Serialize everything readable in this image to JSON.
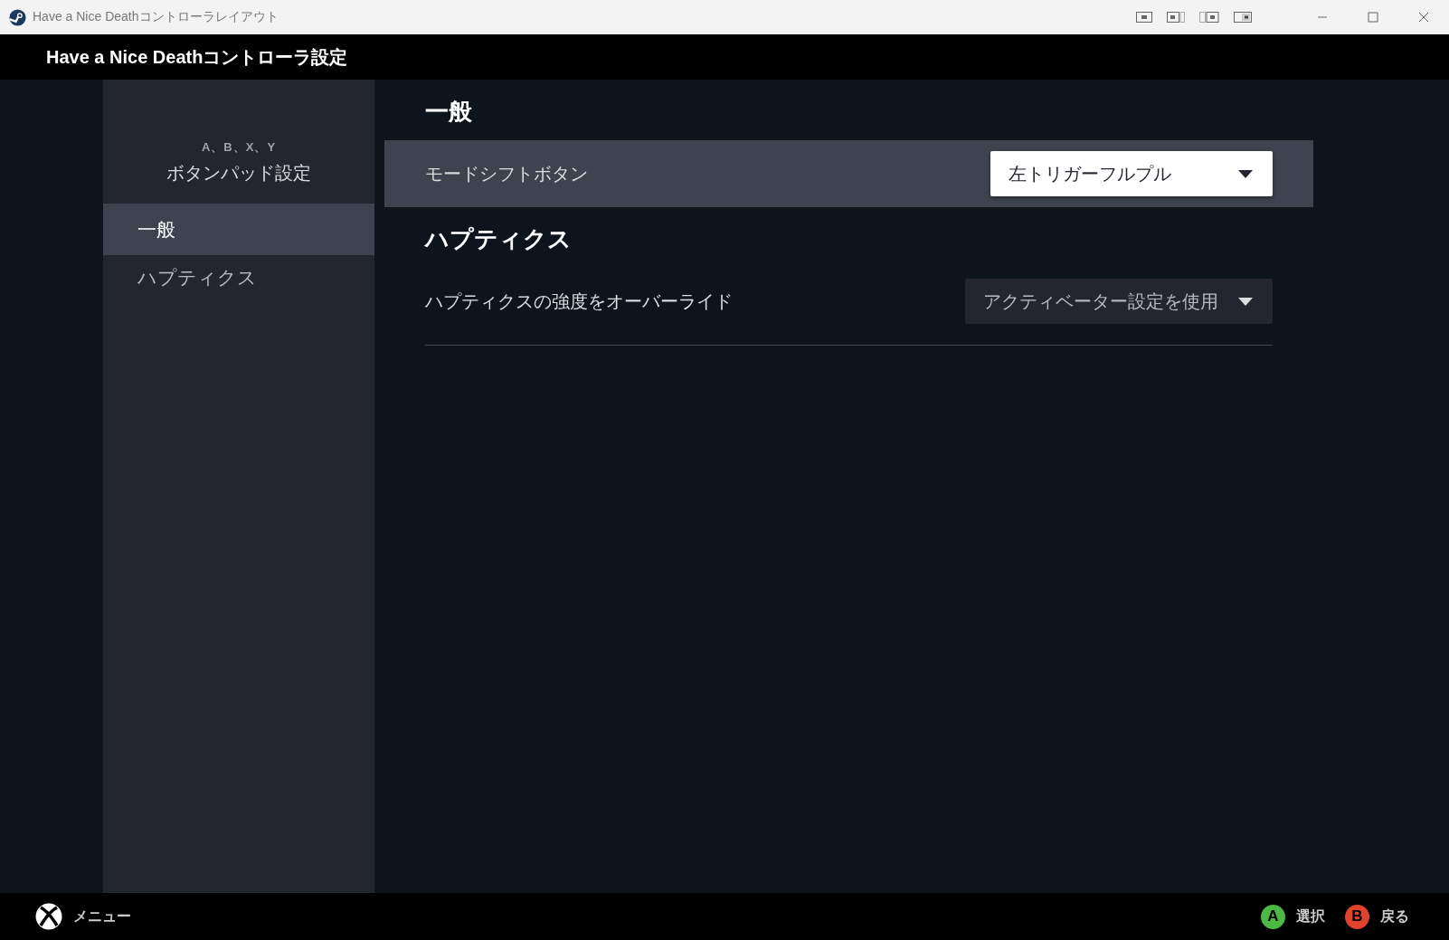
{
  "window": {
    "title": "Have a Nice Deathコントローラレイアウト"
  },
  "header": {
    "title": "Have a Nice Deathコントローラ設定"
  },
  "sidebar": {
    "subtitle": "A、B、X、Y",
    "title": "ボタンパッド設定",
    "items": [
      {
        "label": "一般",
        "selected": true
      },
      {
        "label": "ハプティクス",
        "selected": false
      }
    ]
  },
  "sections": [
    {
      "heading": "一般",
      "rows": [
        {
          "kind": "dropdown",
          "label": "モードシフトボタン",
          "value": "左トリガーフルプル",
          "selected": true,
          "divider": false
        }
      ]
    },
    {
      "heading": "ハプティクス",
      "rows": [
        {
          "kind": "dropdown",
          "label": "ハプティクスの強度をオーバーライド",
          "value": "アクティベーター設定を使用",
          "selected": false,
          "divider": true
        }
      ]
    }
  ],
  "footer": {
    "menu_label": "メニュー",
    "hints": [
      {
        "key": "A",
        "label": "選択",
        "color": "#4cb944"
      },
      {
        "key": "B",
        "label": "戻る",
        "color": "#e0422e"
      }
    ]
  }
}
